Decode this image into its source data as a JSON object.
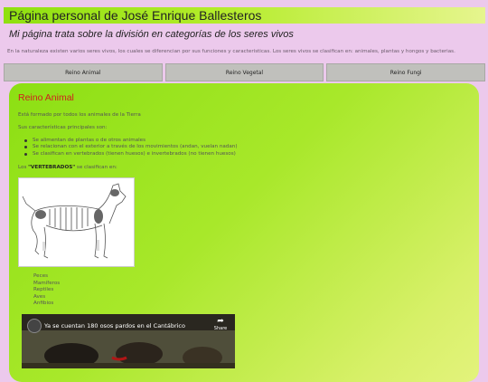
{
  "header": {
    "title": "Página personal de José Enrique Ballesteros"
  },
  "subtitle": "Mi página trata sobre la división en categorías de los seres vivos",
  "intro": "En la naturaleza existen varios seres vivos, los cuales se diferencian por sus funciones y características. Los seres vivos se clasifican en: animales, plantas y hongos y bacterias.",
  "nav": {
    "tabs": [
      {
        "label": "Reino Animal"
      },
      {
        "label": "Reino Vegetal"
      },
      {
        "label": "Reino Fungi"
      }
    ]
  },
  "section": {
    "title": "Reino Animal",
    "formed_by": "Está formado por todos los animales de la Tierra",
    "characteristics_label": "Sus características principales son:",
    "bullets": [
      "Se alimentan de plantas o de otros animales",
      "Se relacionan con el exterior a través de los movimientos (andan, vuelan nadan)",
      "Se clasifican en vertebrados (tienen huesos) e invertebrados (no tienen huesos)"
    ],
    "vertebrates_prefix": "Los ",
    "vertebrates_word": "\"VERTEBRADOS\"",
    "vertebrates_suffix": " se clasifican en:",
    "vertebrate_classes": [
      "Peces",
      "Mamíferos",
      "Reptiles",
      "Aves",
      "Anfibios"
    ],
    "video": {
      "title": "Ya se cuentan 180 osos pardos en el Cantábrico",
      "share_label": "Share"
    }
  }
}
